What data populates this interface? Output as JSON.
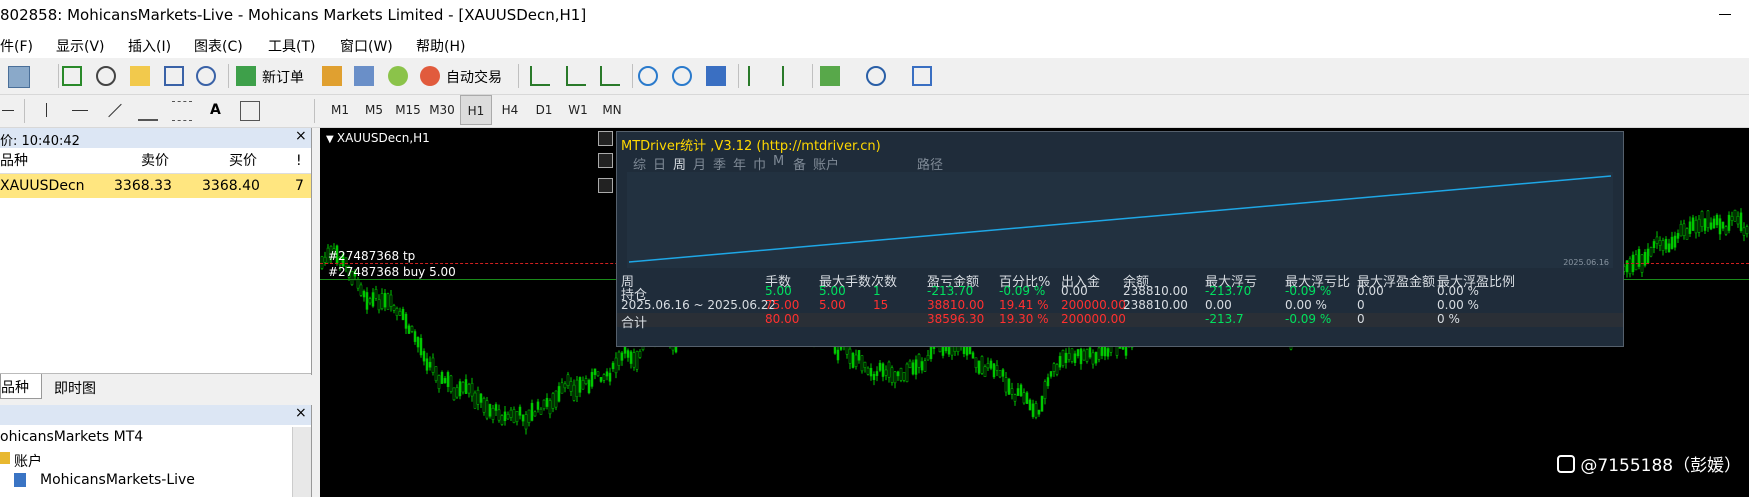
{
  "window": {
    "title": "802858: MohicansMarkets-Live - Mohicans Markets Limited - [XAUUSDecn,H1]"
  },
  "menu": [
    {
      "label": "件(F)"
    },
    {
      "label": "显示(V)"
    },
    {
      "label": "插入(I)"
    },
    {
      "label": "图表(C)"
    },
    {
      "label": "工具(T)"
    },
    {
      "label": "窗口(W)"
    },
    {
      "label": "帮助(H)"
    }
  ],
  "toolbar": {
    "new_order": "新订单",
    "auto_trade": "自动交易"
  },
  "timeframes": [
    "M1",
    "M5",
    "M15",
    "M30",
    "H1",
    "H4",
    "D1",
    "W1",
    "MN"
  ],
  "selected_timeframe": "H1",
  "market_watch": {
    "time_label": "价: 10:40:42",
    "close": "×",
    "headers": {
      "symbol": "品种",
      "bid": "卖价",
      "ask": "买价",
      "extra": "!"
    },
    "rows": [
      {
        "symbol": "XAUUSDecn",
        "bid": "3368.33",
        "ask": "3368.40",
        "extra": "7"
      }
    ]
  },
  "tabs": [
    {
      "label": "品种"
    },
    {
      "label": "即时图"
    }
  ],
  "navigator": {
    "close": "×",
    "items": [
      {
        "label": "ohicansMarkets MT4"
      },
      {
        "label": "账户"
      },
      {
        "label": "MohicansMarkets-Live"
      }
    ]
  },
  "chart": {
    "title": "XAUUSDecn,H1",
    "order_tp": "#27487368 tp",
    "order_buy": "#27487368 buy 5.00"
  },
  "mtdriver": {
    "title": "MTDriver统计 ,V3.12 (http://mtdriver.cn)",
    "tabs": [
      "综",
      "日",
      "周",
      "月",
      "季",
      "年",
      "巾",
      "M",
      "备",
      "账户"
    ],
    "path_tab": "路径",
    "equity_date": "2025.06.16",
    "headers": [
      "周",
      "手数",
      "最大手数",
      "次数",
      "盈亏金额",
      "百分比%",
      "出入金",
      "余额",
      "最大浮亏",
      "最大浮亏比",
      "最大浮盈金额",
      "最大浮盈比例"
    ],
    "rows": [
      {
        "label": "持仓",
        "lots": "5.00",
        "max_lots": "5.00",
        "count": "1",
        "pnl": "-213.70",
        "pct": "-0.09 %",
        "io": "0.00",
        "balance": "238810.00",
        "max_dd": "-213.70",
        "max_dd_pct": "-0.09 %",
        "max_fp": "0.00",
        "max_fp_pct": "0.00 %"
      },
      {
        "label": "2025.06.16 ~ 2025.06.22",
        "lots": "75.00",
        "max_lots": "5.00",
        "count": "15",
        "pnl": "38810.00",
        "pct": "19.41 %",
        "io": "200000.00",
        "balance": "238810.00",
        "max_dd": "0.00",
        "max_dd_pct": "0.00 %",
        "max_fp": "0",
        "max_fp_pct": "0.00 %"
      },
      {
        "label": "合计",
        "lots": "80.00",
        "max_lots": "",
        "count": "",
        "pnl": "38596.30",
        "pct": "19.30 %",
        "io": "200000.00",
        "balance": "",
        "max_dd": "-213.7",
        "max_dd_pct": "-0.09 %",
        "max_fp": "0",
        "max_fp_pct": "0 %"
      }
    ]
  },
  "watermark": {
    "text": "@7155188（彭媛）"
  },
  "colors": {
    "candle": "#00c800",
    "panel_bg": "#1f2c3a",
    "equity_line": "#1ea7e6",
    "highlight_row": "#ffe680",
    "loss": "#ff3030",
    "gain": "#00e060"
  }
}
